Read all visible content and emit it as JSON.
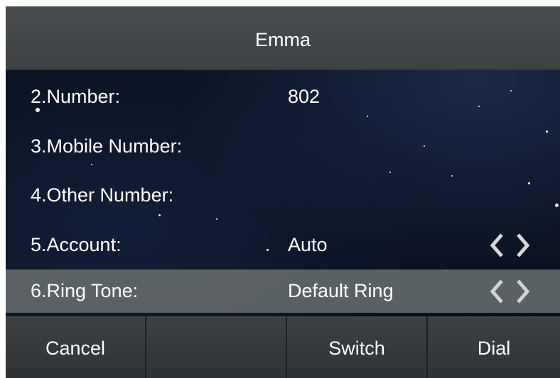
{
  "header": {
    "title": "Emma"
  },
  "fields": [
    {
      "label": "2.Number:",
      "value": "802",
      "selected": false,
      "has_arrows": false
    },
    {
      "label": "3.Mobile Number:",
      "value": "",
      "selected": false,
      "has_arrows": false
    },
    {
      "label": "4.Other Number:",
      "value": "",
      "selected": false,
      "has_arrows": false
    },
    {
      "label": "5.Account:",
      "value": "Auto",
      "selected": false,
      "has_arrows": true
    },
    {
      "label": "6.Ring Tone:",
      "value": "Default Ring",
      "selected": true,
      "has_arrows": true
    }
  ],
  "softkeys": [
    {
      "label": "Cancel"
    },
    {
      "label": ""
    },
    {
      "label": "Switch"
    },
    {
      "label": "Dial"
    }
  ],
  "icons": {
    "prev": "chevron-left-icon",
    "next": "chevron-right-icon"
  },
  "colors": {
    "title_bar": "#44484a",
    "selected_row": "#62686a",
    "background": "#0a1222",
    "text": "#ffffff"
  }
}
